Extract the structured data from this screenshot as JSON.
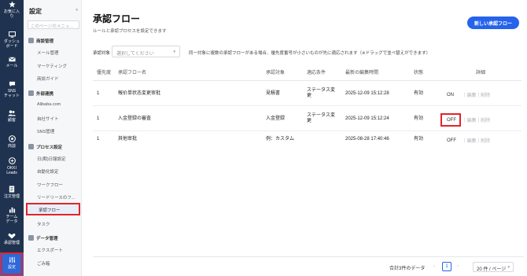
{
  "rail": {
    "items": [
      {
        "label": "お気に入\nり",
        "icon": "star-icon"
      },
      {
        "label": "ダッシュ\nボード",
        "icon": "dashboard-icon"
      },
      {
        "label": "メール",
        "icon": "mail-icon"
      },
      {
        "label": "SNS\nチャット",
        "icon": "chat-icon"
      },
      {
        "label": "顧客",
        "icon": "customers-icon"
      },
      {
        "label": "商談",
        "icon": "deal-icon"
      },
      {
        "label": "OKKI\nLeads",
        "icon": "leads-icon"
      },
      {
        "label": "注文管理",
        "icon": "orders-icon"
      },
      {
        "label": "チーム\nデータ",
        "icon": "chart-icon"
      },
      {
        "label": "承認管理",
        "icon": "approval-icon"
      },
      {
        "label": "設定",
        "icon": "settings-icon"
      }
    ]
  },
  "sidebar": {
    "title": "設定",
    "collapse": "«",
    "search_placeholder": "このページのメニュ...",
    "groups": [
      {
        "label": "商談管理",
        "items": [
          "メール管理",
          "マーケティング",
          "商談ガイド"
        ]
      },
      {
        "label": "外部連携",
        "items": [
          "Alibaba.com",
          "自社サイト",
          "SNS管理"
        ]
      },
      {
        "label": "プロセス設定",
        "items": [
          "日(期)日報設定",
          "自動化設定",
          "ワークフロー",
          "リードリースのフ...",
          "承認フロー",
          "タスク"
        ]
      },
      {
        "label": "データ管理",
        "items": [
          "エクスポート",
          "ごみ箱"
        ]
      }
    ]
  },
  "main": {
    "title": "承認フロー",
    "subtitle": "ルールと承認プロセスを設定できます",
    "new_button": "新しい承認フロー",
    "filter_label": "承認対象",
    "filter_placeholder": "選択してください",
    "filter_note": "同一対象に複数の承認フローがある場合、優先度番号が小さいものが先に適応されます（※ドラッグで並べ替えができます）",
    "headers": [
      "優先度",
      "承認フロー名",
      "承認対象",
      "適応条件",
      "最新の編集時間",
      "状態",
      "詳細"
    ],
    "rows": [
      {
        "priority": "1",
        "name": "報价单状态変更审批",
        "target": "見積書",
        "condition": "ステータス変\n更",
        "time": "2025-12-09 15:12:28",
        "state": "有効",
        "toggle": "ON",
        "edit": "編集",
        "delete": "削除"
      },
      {
        "priority": "1",
        "name": "入金登録の審査",
        "target": "入金登録",
        "condition": "ステータス変\n更",
        "time": "2025-12-09 15:12:24",
        "state": "有効",
        "toggle": "OFF",
        "edit": "編集",
        "delete": "削除"
      },
      {
        "priority": "1",
        "name": "其他审批",
        "target": "例：カスタム",
        "condition": "",
        "time": "2025-08-28 17:40:46",
        "state": "有効",
        "toggle": "OFF",
        "edit": "編集",
        "delete": "削除"
      }
    ]
  },
  "pager": {
    "total": "合計3件のデータ",
    "prev": "‹",
    "page": "1",
    "next": "›",
    "page_size": "20 件 / ページ"
  },
  "colors": {
    "rail": "#1f3350",
    "accent": "#2563eb",
    "highlight": "#e0252a"
  }
}
